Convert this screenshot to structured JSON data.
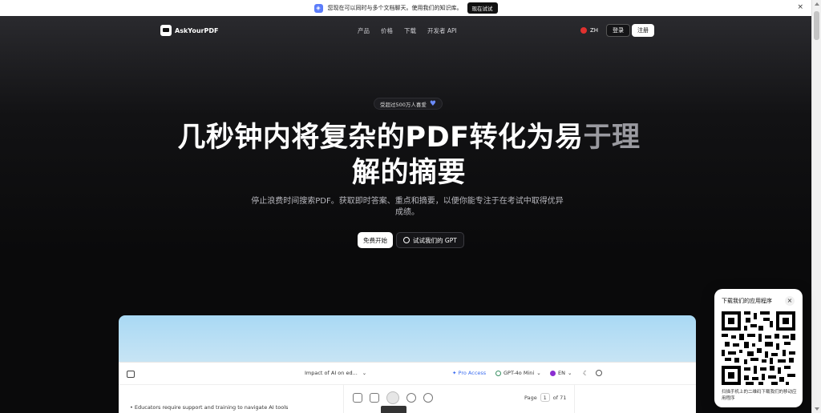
{
  "announcement": {
    "text": "您现在可以同时与多个文档聊天。使用我们的知识库。",
    "cta": "现在试试",
    "close": "×"
  },
  "nav": {
    "brand": "AskYourPDF",
    "links": [
      "产品",
      "价格",
      "下载",
      "开发者 API"
    ],
    "language": "ZH",
    "login": "登录",
    "register": "注册"
  },
  "hero": {
    "badge": "受超过500万人喜爱",
    "headline_line1_main": "几秒钟内将复杂的PDF转化为易",
    "headline_line1_fade": "于理",
    "headline_line2": "解的摘要",
    "subtitle": "停止浪费时间搜索PDF。获取即时答案、重点和摘要，以便你能专注于在考试中取得优异成绩。",
    "cta_primary": "免费开始",
    "cta_secondary": "试试我们的 GPT"
  },
  "preview": {
    "doc_title": "Impact of AI on ed...",
    "pro_access": "Pro Access",
    "model": "GPT-4o Mini",
    "language": "EN",
    "page_label": "Page",
    "page_current": "1",
    "page_total": "of 71",
    "bullet": "Educators require support and training to navigate AI tools"
  },
  "qr_popup": {
    "title": "下载我们的应用程序",
    "close": "×",
    "caption": "扫描手机上的二维码下载我们的移动应用程序"
  },
  "colors": {
    "accent": "#3b6cf0",
    "heart": "#6b8cff",
    "background": "#0b0b0d"
  }
}
